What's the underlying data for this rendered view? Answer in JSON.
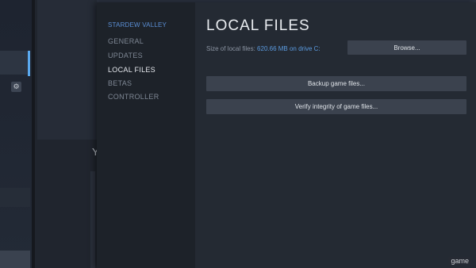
{
  "background": {
    "partial_heading": "Y"
  },
  "game_title": "STARDEW VALLEY",
  "nav": {
    "items": [
      "GENERAL",
      "UPDATES",
      "LOCAL FILES",
      "BETAS",
      "CONTROLLER"
    ],
    "active": "LOCAL FILES"
  },
  "page": {
    "heading": "LOCAL FILES",
    "size_label": "Size of local files:",
    "size_value": "620.66 MB on drive C:",
    "browse_label": "Browse...",
    "backup_label": "Backup game files...",
    "verify_label": "Verify integrity of game files..."
  },
  "watermark": "game",
  "colors": {
    "accent": "#5b9be0",
    "dialog_bg": "#242a33",
    "nav_bg": "#1d2229",
    "button_bg": "#3b424e"
  }
}
